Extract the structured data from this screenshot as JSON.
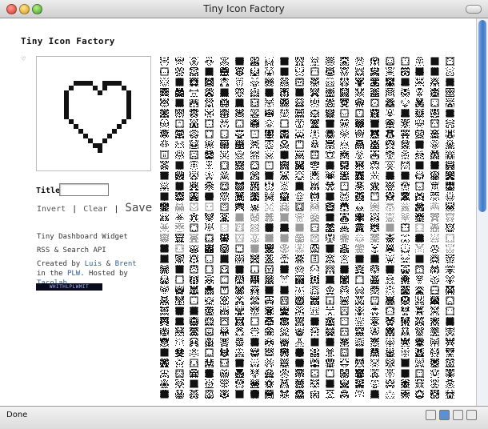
{
  "window": {
    "title": "Tiny Icon Factory"
  },
  "page": {
    "heading": "Tiny Icon Factory",
    "heart_glyph": "♡"
  },
  "editor": {
    "title_label": "Title",
    "title_value": "",
    "invert_label": "Invert",
    "clear_label": "Clear",
    "save_label": "Save",
    "separator": "|"
  },
  "info": {
    "dashboard_link": "Tiny Dashboard Widget",
    "rss_link": "RSS",
    "amp": "&",
    "search_api_link": "Search API",
    "credits_created_by": "Created by",
    "author1": "Luis",
    "author2": "Brent",
    "in_the": "in the",
    "plw": "PLW",
    "hosted_by": ". Hosted by",
    "host": "Tacolab",
    "period": ".",
    "badge_text": "WHITHLPLWMIT"
  },
  "status": {
    "text": "Done"
  },
  "icon_grid": {
    "columns": 20,
    "rows": 33
  },
  "colors": {
    "link": "#2f5f9e",
    "scroll": "#3d78c8",
    "ink": "#111111"
  }
}
